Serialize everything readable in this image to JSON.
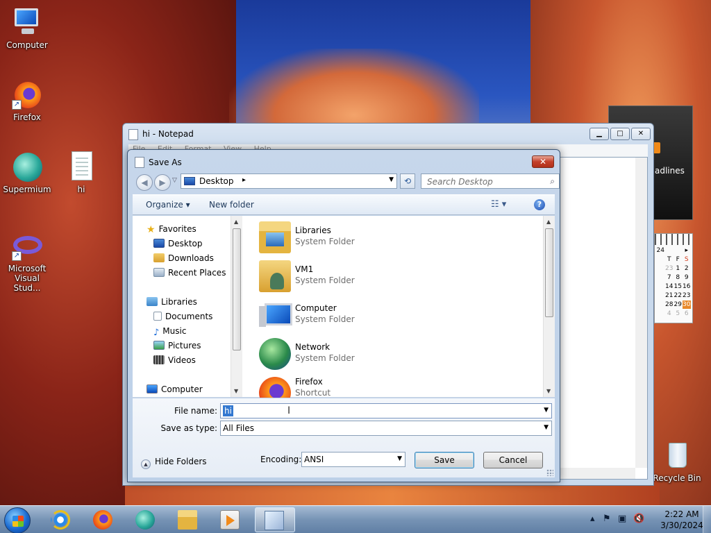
{
  "desktop": {
    "icons": [
      {
        "label": "Computer"
      },
      {
        "label": "Firefox"
      },
      {
        "label": "Supermium"
      },
      {
        "label": "hi"
      },
      {
        "label": "Microsoft Visual Stud..."
      },
      {
        "label": "Recycle Bin"
      }
    ]
  },
  "gadgets": {
    "headlines_text": "adlines",
    "calendar": {
      "month_digits": "24",
      "weekday_headers": [
        "T",
        "F",
        "S"
      ],
      "rows": [
        [
          "23",
          "1",
          "2"
        ],
        [
          "7",
          "8",
          "9"
        ],
        [
          "14",
          "15",
          "16"
        ],
        [
          "21",
          "22",
          "23"
        ],
        [
          "28",
          "29",
          "30"
        ],
        [
          "4",
          "5",
          "6"
        ]
      ]
    }
  },
  "notepad": {
    "title": "hi - Notepad",
    "menu": [
      "File",
      "Edit",
      "Format",
      "View",
      "Help"
    ],
    "minimize": "▁",
    "maximize": "□",
    "close": "✕"
  },
  "dialog": {
    "title": "Save As",
    "close": "✕",
    "address": {
      "location": "Desktop",
      "chevron": "▸"
    },
    "search": {
      "placeholder": "Search Desktop"
    },
    "toolbar": {
      "organize": "Organize ▾",
      "new_folder": "New folder",
      "views": "☷ ▾",
      "help": "?"
    },
    "nav_pane": {
      "favorites": {
        "label": "Favorites",
        "items": [
          "Desktop",
          "Downloads",
          "Recent Places"
        ]
      },
      "libraries": {
        "label": "Libraries",
        "items": [
          "Documents",
          "Music",
          "Pictures",
          "Videos"
        ]
      },
      "computer": {
        "label": "Computer"
      }
    },
    "files": [
      {
        "name": "Libraries",
        "type": "System Folder"
      },
      {
        "name": "VM1",
        "type": "System Folder"
      },
      {
        "name": "Computer",
        "type": "System Folder"
      },
      {
        "name": "Network",
        "type": "System Folder"
      },
      {
        "name": "Firefox",
        "type": "Shortcut"
      }
    ],
    "form": {
      "file_name_label": "File name:",
      "file_name_value": "hi",
      "save_type_label": "Save as type:",
      "save_type_value": "All Files",
      "hide_folders": "Hide Folders",
      "encoding_label": "Encoding:",
      "encoding_value": "ANSI",
      "save": "Save",
      "cancel": "Cancel"
    }
  },
  "taskbar": {
    "clock": {
      "time": "2:22 AM",
      "date": "3/30/2024"
    }
  }
}
